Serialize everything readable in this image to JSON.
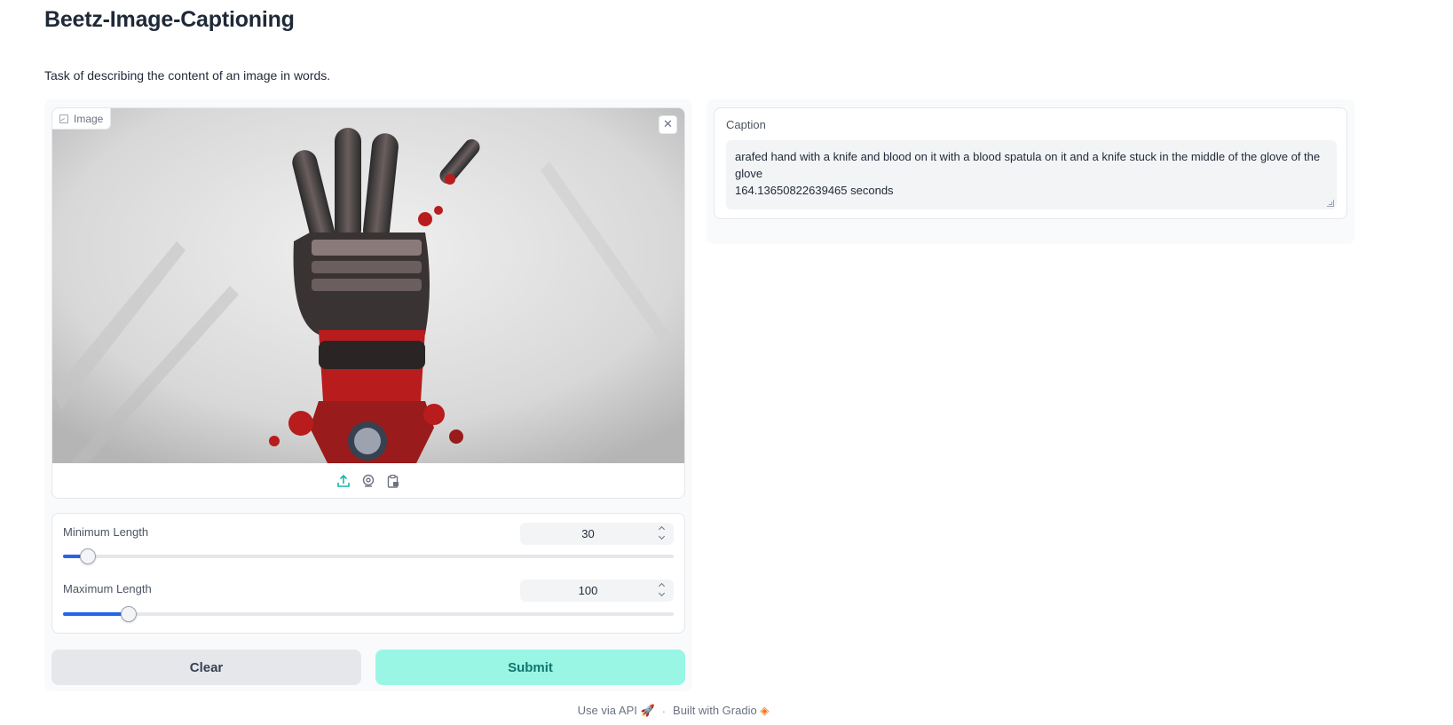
{
  "app": {
    "title": "Beetz-Image-Captioning",
    "description": "Task of describing the content of an image in words."
  },
  "image_input": {
    "label": "Image",
    "source_icons": [
      "upload-icon",
      "webcam-icon",
      "clipboard-icon"
    ]
  },
  "sliders": [
    {
      "label": "Minimum Length",
      "value": "30",
      "fraction": 0.04
    },
    {
      "label": "Maximum Length",
      "value": "100",
      "fraction": 0.108
    }
  ],
  "buttons": {
    "clear_label": "Clear",
    "submit_label": "Submit"
  },
  "output": {
    "label": "Caption",
    "caption_text": "arafed hand with a knife and blood on it with a blood spatula on it and a knife stuck in the middle of the glove of the glove",
    "timing_text": "164.13650822639465 seconds"
  },
  "footer": {
    "api_label": "Use via API",
    "built_label": "Built with Gradio"
  },
  "colors": {
    "accent_slider": "#2563eb",
    "submit_bg": "#99f6e4",
    "submit_text": "#0f766e",
    "clear_bg": "#e5e7eb"
  }
}
